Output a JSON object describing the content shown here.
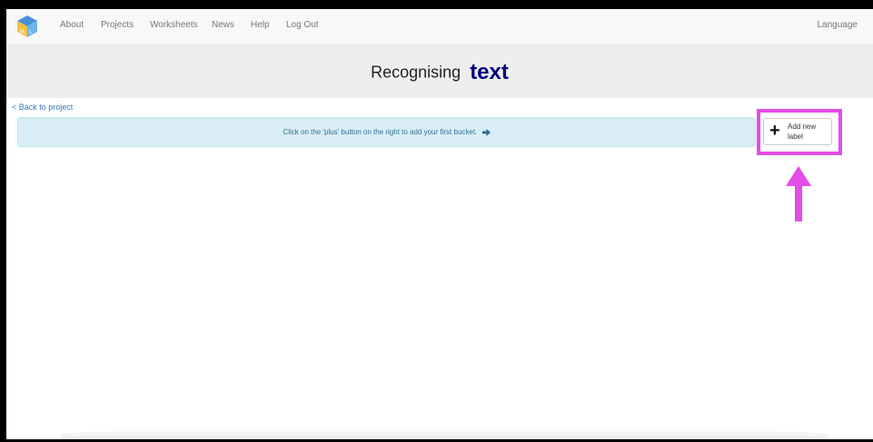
{
  "navbar": {
    "links": [
      {
        "label": "About"
      },
      {
        "label": "Projects"
      },
      {
        "label": "Worksheets"
      },
      {
        "label": "News"
      },
      {
        "label": "Help"
      },
      {
        "label": "Log Out"
      }
    ],
    "language_label": "Language"
  },
  "header": {
    "title": "Recognising",
    "project_type": "text"
  },
  "back_link": "< Back to project",
  "info_message": "Click on the 'plus' button on the right to add your first bucket.",
  "info_arrow_icon": "arrow-right-icon",
  "add_label_button": {
    "icon": "plus-icon",
    "label": "Add new label"
  },
  "annotation": {
    "highlight_color": "#e44ce8",
    "arrow_direction": "up"
  },
  "colors": {
    "project_type_text": "#000080",
    "info_background": "#d9edf7",
    "link": "#337ab7"
  }
}
